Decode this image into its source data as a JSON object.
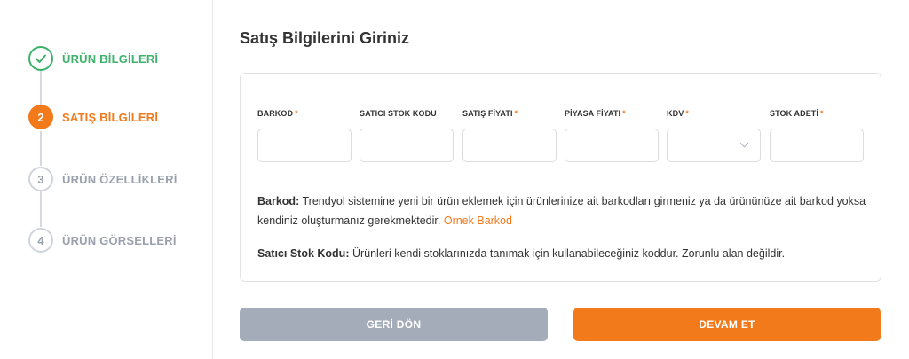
{
  "steps": [
    {
      "number": "1",
      "label": "ÜRÜN BİLGİLERİ",
      "state": "done"
    },
    {
      "number": "2",
      "label": "SATIŞ BİLGİLERİ",
      "state": "active"
    },
    {
      "number": "3",
      "label": "ÜRÜN ÖZELLİKLERİ",
      "state": "pending"
    },
    {
      "number": "4",
      "label": "ÜRÜN GÖRSELLERİ",
      "state": "pending"
    }
  ],
  "page_title": "Satış Bilgilerini Giriniz",
  "fields": [
    {
      "label": "BARKOD",
      "required": "*",
      "value": ""
    },
    {
      "label": "SATICI STOK KODU",
      "required": "",
      "value": ""
    },
    {
      "label": "SATIŞ FİYATI",
      "required": "*",
      "value": ""
    },
    {
      "label": "PİYASA FİYATI",
      "required": "*",
      "value": ""
    },
    {
      "label": "KDV",
      "required": "*",
      "value": ""
    },
    {
      "label": "STOK ADETİ",
      "required": "*",
      "value": ""
    }
  ],
  "info": {
    "barcode_title": "Barkod:",
    "barcode_text": "Trendyol sistemine yeni bir ürün eklemek için ürünlerinize ait barkodları girmeniz ya da ürününüze ait barkod yoksa kendiniz oluşturmanız gerekmektedir.",
    "barcode_link": "Örnek Barkod",
    "stock_title": "Satıcı Stok Kodu:",
    "stock_text": "Ürünleri kendi stoklarınızda tanımak için kullanabileceğiniz koddur. Zorunlu alan değildir."
  },
  "buttons": {
    "back": "GERİ DÖN",
    "next": "DEVAM ET"
  },
  "colors": {
    "accent": "#f27a1a",
    "success": "#3db26b",
    "muted": "#9aa1ad",
    "back_button": "#a5acb9"
  },
  "icons": {
    "done_step": "check-icon",
    "select_arrow": "chevron-down-icon"
  }
}
